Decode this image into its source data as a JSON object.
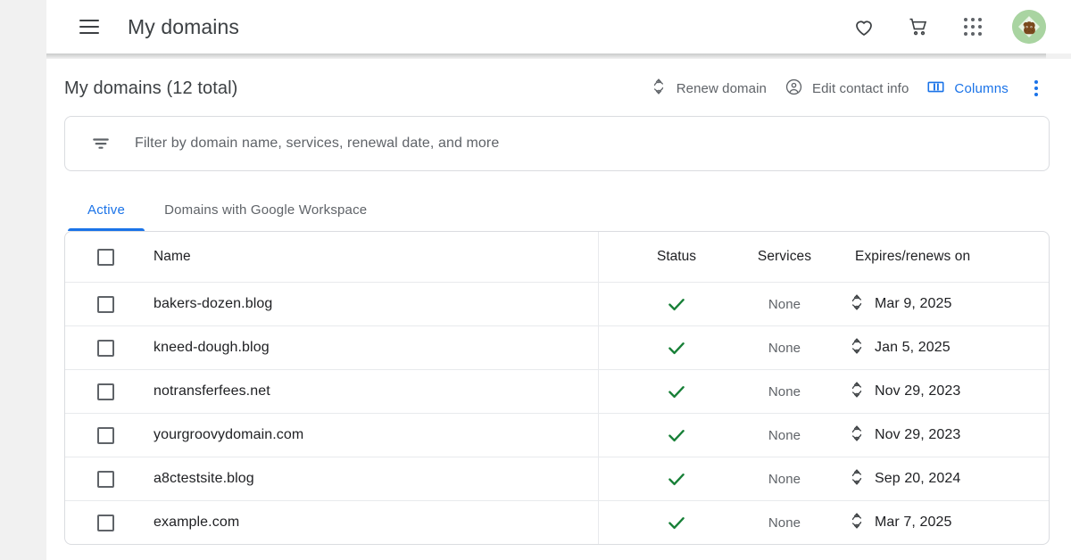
{
  "appbar": {
    "menu_icon": "hamburger-menu-icon",
    "title": "My domains",
    "actions": [
      {
        "name": "favorites-icon",
        "label": "Favorites"
      },
      {
        "name": "cart-icon",
        "label": "Cart"
      },
      {
        "name": "apps-grid-icon",
        "label": "Google apps"
      }
    ],
    "avatar_label": "Account avatar"
  },
  "page": {
    "title": "My domains (12 total)",
    "total": 12
  },
  "toolbar": {
    "renew_domain": "Renew domain",
    "renew_icon": "renew-icon",
    "edit_contact_info": "Edit contact info",
    "edit_contact_icon": "account-circle-icon",
    "columns": "Columns",
    "columns_icon": "columns-icon",
    "more_icon": "more-vert-icon",
    "accent_color": "#1a73e8",
    "muted_color": "#5f6368"
  },
  "filter": {
    "icon": "filter-list-icon",
    "placeholder": "Filter by domain name, services, renewal date, and more",
    "value": ""
  },
  "tabs": [
    {
      "label": "Active",
      "active": true
    },
    {
      "label": "Domains with Google Workspace",
      "active": false
    }
  ],
  "table": {
    "columns": [
      "Name",
      "Status",
      "Services",
      "Expires/renews on"
    ],
    "select_all_checked": false,
    "status_icon": "check-icon",
    "status_color": "#188038",
    "renew_icon": "renew-icon",
    "rows": [
      {
        "name": "bakers-dozen.blog",
        "checked": false,
        "status": "active",
        "services": "None",
        "expires": "Mar 9, 2025"
      },
      {
        "name": "kneed-dough.blog",
        "checked": false,
        "status": "active",
        "services": "None",
        "expires": "Jan 5, 2025"
      },
      {
        "name": "notransferfees.net",
        "checked": false,
        "status": "active",
        "services": "None",
        "expires": "Nov 29, 2023"
      },
      {
        "name": "yourgroovydomain.com",
        "checked": false,
        "status": "active",
        "services": "None",
        "expires": "Nov 29, 2023"
      },
      {
        "name": "a8ctestsite.blog",
        "checked": false,
        "status": "active",
        "services": "None",
        "expires": "Sep 20, 2024"
      },
      {
        "name": "example.com",
        "checked": false,
        "status": "active",
        "services": "None",
        "expires": "Mar 7, 2025"
      }
    ]
  }
}
